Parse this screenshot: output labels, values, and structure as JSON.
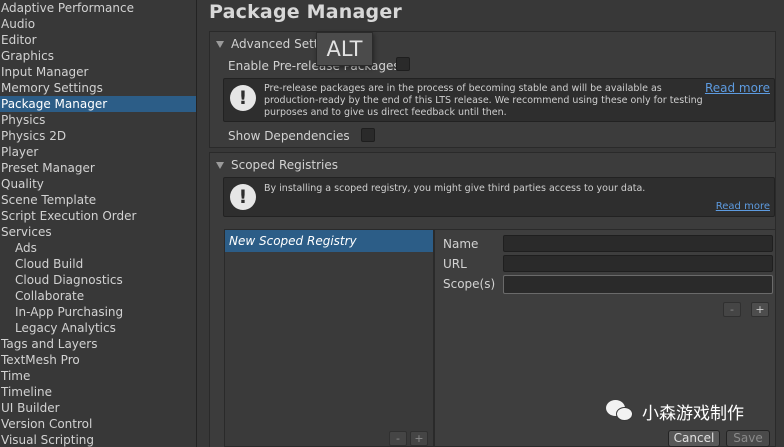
{
  "sidebar": {
    "items": [
      {
        "label": "Adaptive Performance",
        "sub": false
      },
      {
        "label": "Audio",
        "sub": false
      },
      {
        "label": "Editor",
        "sub": false
      },
      {
        "label": "Graphics",
        "sub": false
      },
      {
        "label": "Input Manager",
        "sub": false
      },
      {
        "label": "Memory Settings",
        "sub": false
      },
      {
        "label": "Package Manager",
        "sub": false,
        "selected": true
      },
      {
        "label": "Physics",
        "sub": false
      },
      {
        "label": "Physics 2D",
        "sub": false
      },
      {
        "label": "Player",
        "sub": false
      },
      {
        "label": "Preset Manager",
        "sub": false
      },
      {
        "label": "Quality",
        "sub": false
      },
      {
        "label": "Scene Template",
        "sub": false
      },
      {
        "label": "Script Execution Order",
        "sub": false
      },
      {
        "label": "Services",
        "sub": false
      },
      {
        "label": "Ads",
        "sub": true
      },
      {
        "label": "Cloud Build",
        "sub": true
      },
      {
        "label": "Cloud Diagnostics",
        "sub": true
      },
      {
        "label": "Collaborate",
        "sub": true
      },
      {
        "label": "In-App Purchasing",
        "sub": true
      },
      {
        "label": "Legacy Analytics",
        "sub": true
      },
      {
        "label": "Tags and Layers",
        "sub": false
      },
      {
        "label": "TextMesh Pro",
        "sub": false
      },
      {
        "label": "Time",
        "sub": false
      },
      {
        "label": "Timeline",
        "sub": false
      },
      {
        "label": "UI Builder",
        "sub": false
      },
      {
        "label": "Version Control",
        "sub": false
      },
      {
        "label": "Visual Scripting",
        "sub": false
      }
    ]
  },
  "main": {
    "title": "Package Manager",
    "advanced": {
      "header": "Advanced Settings",
      "enable_prerelease_label": "Enable Pre-release Packages",
      "prerelease_help_line1": "Pre-release packages are in the process of becoming stable and will be available as",
      "prerelease_help_line2": "production-ready by the end of this LTS release. We recommend using these only for testing",
      "prerelease_help_line3": "purposes and to give us direct feedback until then.",
      "read_more": "Read more",
      "show_dependencies_label": "Show Dependencies"
    },
    "scoped": {
      "header": "Scoped Registries",
      "help_text": "By installing a scoped registry, you might give third parties access to your data.",
      "read_more": "Read more",
      "registry_item": "New Scoped Registry",
      "name_label": "Name",
      "url_label": "URL",
      "scopes_label": "Scope(s)",
      "minus": "-",
      "plus": "+",
      "cancel": "Cancel",
      "save": "Save"
    }
  },
  "tooltip": "ALT",
  "watermark": "小森游戏制作",
  "colors": {
    "selected": "#2c5d87",
    "link": "#5d9be0",
    "background": "#383838"
  }
}
